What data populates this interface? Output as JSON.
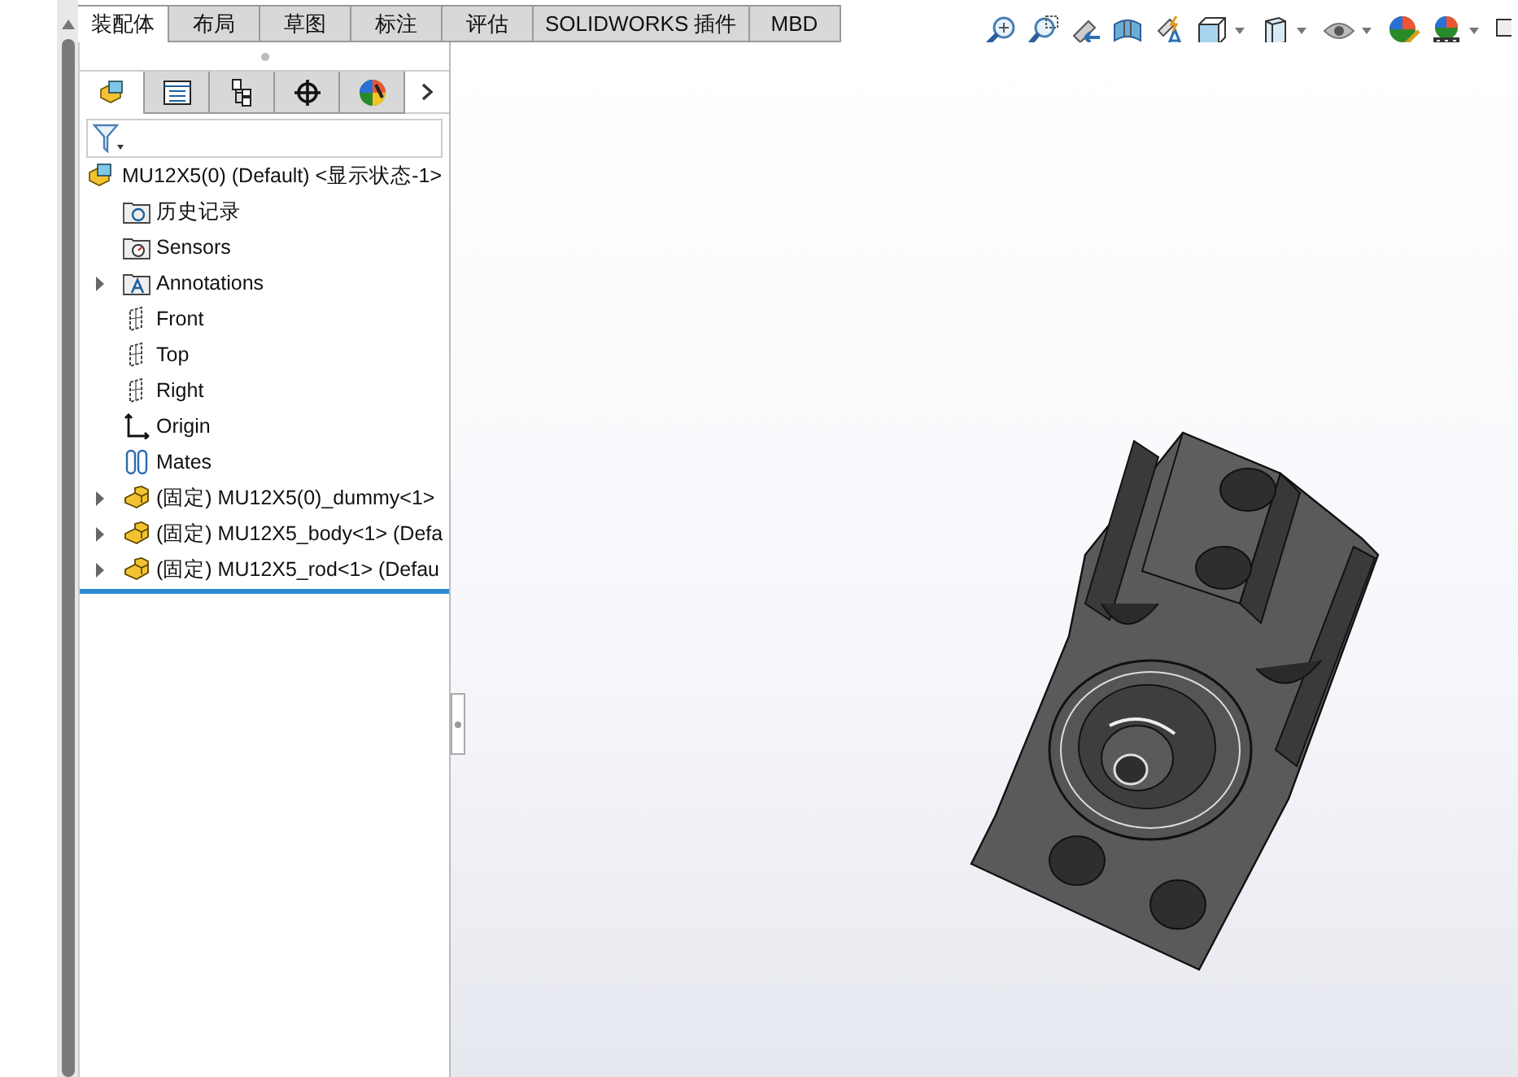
{
  "command_tabs": [
    {
      "label": "装配体",
      "selected": true
    },
    {
      "label": "布局",
      "selected": false
    },
    {
      "label": "草图",
      "selected": false
    },
    {
      "label": "标注",
      "selected": false
    },
    {
      "label": "评估",
      "selected": false
    },
    {
      "label": "SOLIDWORKS 插件",
      "selected": false
    },
    {
      "label": "MBD",
      "selected": false
    }
  ],
  "panel_tabs": [
    {
      "kind": "feature-tree",
      "selected": true
    },
    {
      "kind": "property",
      "selected": false
    },
    {
      "kind": "configuration",
      "selected": false
    },
    {
      "kind": "dimxpert",
      "selected": false
    },
    {
      "kind": "appearance",
      "selected": false
    }
  ],
  "tree": {
    "root": {
      "label": "MU12X5(0) (Default) <显示状态-1>"
    },
    "children": [
      {
        "kind": "history",
        "label": "历史记录",
        "expandable": false
      },
      {
        "kind": "sensors",
        "label": "Sensors",
        "expandable": false
      },
      {
        "kind": "annotations",
        "label": "Annotations",
        "expandable": true
      },
      {
        "kind": "plane",
        "label": "Front",
        "expandable": false
      },
      {
        "kind": "plane",
        "label": "Top",
        "expandable": false
      },
      {
        "kind": "plane",
        "label": "Right",
        "expandable": false
      },
      {
        "kind": "origin",
        "label": "Origin",
        "expandable": false
      },
      {
        "kind": "mates",
        "label": "Mates",
        "expandable": false
      },
      {
        "kind": "part",
        "label": "(固定) MU12X5(0)_dummy<1>",
        "expandable": true
      },
      {
        "kind": "part",
        "label": "(固定) MU12X5_body<1> (Defa",
        "expandable": true
      },
      {
        "kind": "part",
        "label": "(固定) MU12X5_rod<1> (Defau",
        "expandable": true
      }
    ]
  }
}
